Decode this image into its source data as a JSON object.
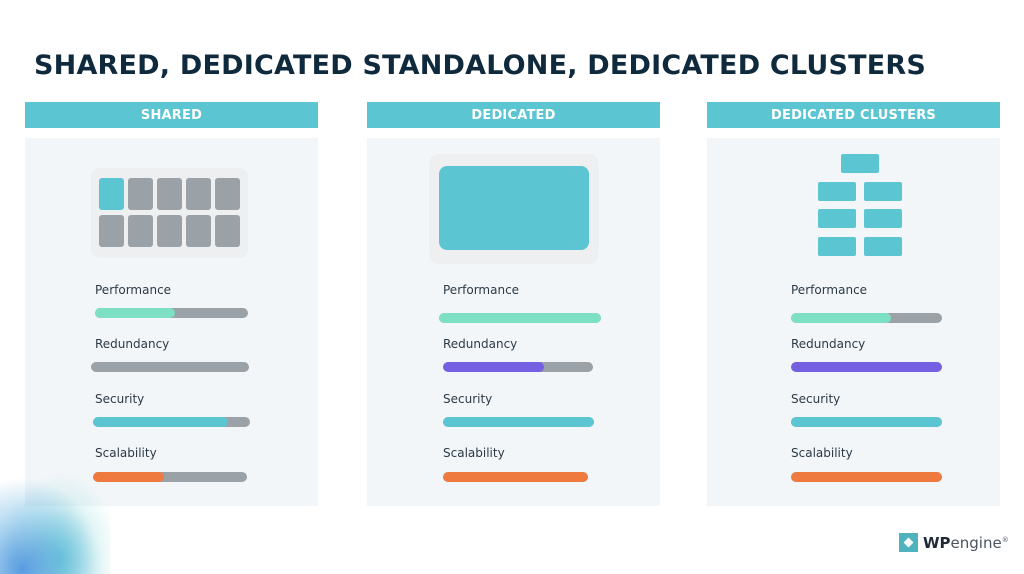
{
  "title": "SHARED, DEDICATED STANDALONE, DEDICATED CLUSTERS",
  "colors": {
    "header": "#5bc5d1",
    "track": "#9aa1a7",
    "performance": "#7ddfc3",
    "redundancy": "#7460e1",
    "security": "#5bc5d1",
    "scalability": "#ef7a40"
  },
  "columns": [
    {
      "header": "SHARED",
      "icon": "shared-server-grid-icon",
      "metrics": [
        {
          "label": "Performance",
          "value": 0.52,
          "color_key": "performance"
        },
        {
          "label": "Redundancy",
          "value": 0.0,
          "color_key": "redundancy"
        },
        {
          "label": "Security",
          "value": 0.86,
          "color_key": "security"
        },
        {
          "label": "Scalability",
          "value": 0.46,
          "color_key": "scalability"
        }
      ]
    },
    {
      "header": "DEDICATED",
      "icon": "dedicated-server-icon",
      "metrics": [
        {
          "label": "Performance",
          "value": 1.0,
          "color_key": "performance"
        },
        {
          "label": "Redundancy",
          "value": 0.67,
          "color_key": "redundancy"
        },
        {
          "label": "Security",
          "value": 1.0,
          "color_key": "security"
        },
        {
          "label": "Scalability",
          "value": 1.0,
          "color_key": "scalability"
        }
      ]
    },
    {
      "header": "DEDICATED CLUSTERS",
      "icon": "server-cluster-icon",
      "metrics": [
        {
          "label": "Performance",
          "value": 0.66,
          "color_key": "performance"
        },
        {
          "label": "Redundancy",
          "value": 1.0,
          "color_key": "redundancy"
        },
        {
          "label": "Security",
          "value": 1.0,
          "color_key": "security"
        },
        {
          "label": "Scalability",
          "value": 1.0,
          "color_key": "scalability"
        }
      ]
    }
  ],
  "logo": {
    "wp": "WP",
    "engine": "engine",
    "mark": "®"
  }
}
